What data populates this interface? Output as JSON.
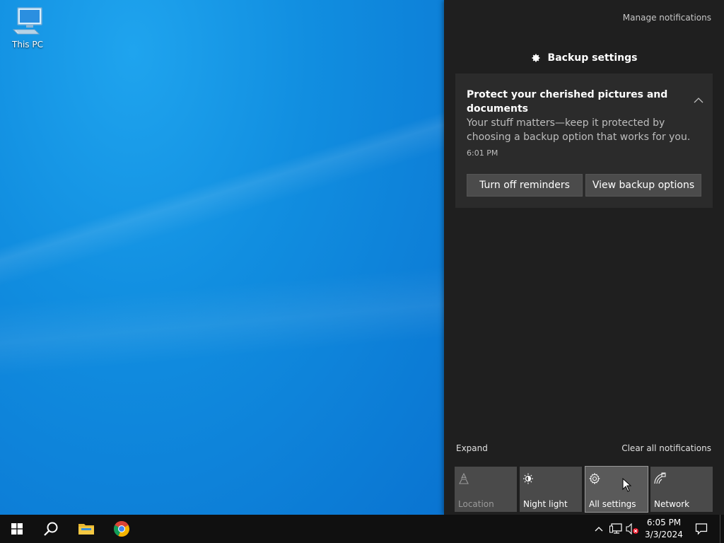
{
  "desktop": {
    "icons": [
      {
        "label": "This PC",
        "icon": "this-pc-icon"
      }
    ]
  },
  "action_center": {
    "manage_notifications": "Manage notifications",
    "group": {
      "title": "Backup settings",
      "icon": "gear-icon"
    },
    "notification": {
      "title": "Protect your cherished pictures and documents",
      "body": "Your stuff matters—keep it protected by choosing a backup option that works for you.",
      "time": "6:01 PM",
      "buttons": {
        "turn_off": "Turn off reminders",
        "view_options": "View backup options"
      }
    },
    "expand": "Expand",
    "clear_all": "Clear all notifications",
    "quick_actions": [
      {
        "label": "Location",
        "icon": "location-icon",
        "state": "disabled"
      },
      {
        "label": "Night light",
        "icon": "night-light-icon",
        "state": "off"
      },
      {
        "label": "All settings",
        "icon": "settings-icon",
        "state": "hover"
      },
      {
        "label": "Network",
        "icon": "network-icon",
        "state": "off"
      }
    ]
  },
  "taskbar": {
    "apps": [
      "start-icon",
      "search-icon",
      "file-explorer-icon",
      "chrome-icon"
    ],
    "tray": {
      "time": "6:05 PM",
      "date": "3/3/2024"
    }
  },
  "colors": {
    "panel_bg": "#1f1f1f",
    "card_bg": "#2b2b2b",
    "button_bg": "#4b4b4b",
    "tile_bg": "#4a4a4a",
    "taskbar_bg": "#101010",
    "wallpaper": "#0b78d4"
  }
}
